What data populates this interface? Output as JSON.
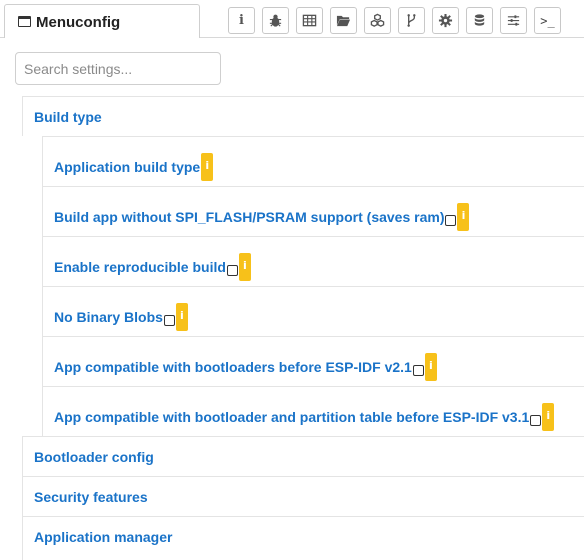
{
  "tab": {
    "label": "Menuconfig",
    "icon": "window-icon"
  },
  "toolbar": {
    "buttons": [
      {
        "name": "info-button",
        "icon": "info-icon"
      },
      {
        "name": "debug-button",
        "icon": "bug-icon"
      },
      {
        "name": "table-button",
        "icon": "table-icon"
      },
      {
        "name": "folder-button",
        "icon": "folder-open-icon"
      },
      {
        "name": "components-button",
        "icon": "cubes-icon"
      },
      {
        "name": "branch-button",
        "icon": "branch-icon"
      },
      {
        "name": "settings-button",
        "icon": "gear-icon"
      },
      {
        "name": "database-button",
        "icon": "database-icon"
      },
      {
        "name": "sliders-button",
        "icon": "sliders-icon"
      },
      {
        "name": "terminal-button",
        "icon": "terminal-icon"
      }
    ],
    "info_glyph": "i",
    "terminal_glyph": ">_"
  },
  "search": {
    "placeholder": "Search settings...",
    "value": ""
  },
  "sections": [
    {
      "label": "Build type"
    },
    {
      "label": "Bootloader config"
    },
    {
      "label": "Security features"
    },
    {
      "label": "Application manager"
    }
  ],
  "build_type_items": [
    {
      "label": "Application build type",
      "has_checkbox": false,
      "checked": false
    },
    {
      "label": "Build app without SPI_FLASH/PSRAM support (saves ram)",
      "has_checkbox": true,
      "checked": false
    },
    {
      "label": "Enable reproducible build",
      "has_checkbox": true,
      "checked": false
    },
    {
      "label": "No Binary Blobs",
      "has_checkbox": true,
      "checked": false
    },
    {
      "label": "App compatible with bootloaders before ESP-IDF v2.1",
      "has_checkbox": true,
      "checked": false
    },
    {
      "label": "App compatible with bootloader and partition table before ESP-IDF v3.1",
      "has_checkbox": true,
      "checked": false
    }
  ],
  "info_badge": "i",
  "colors": {
    "link": "#1a73c8",
    "badge": "#f7c11a"
  }
}
